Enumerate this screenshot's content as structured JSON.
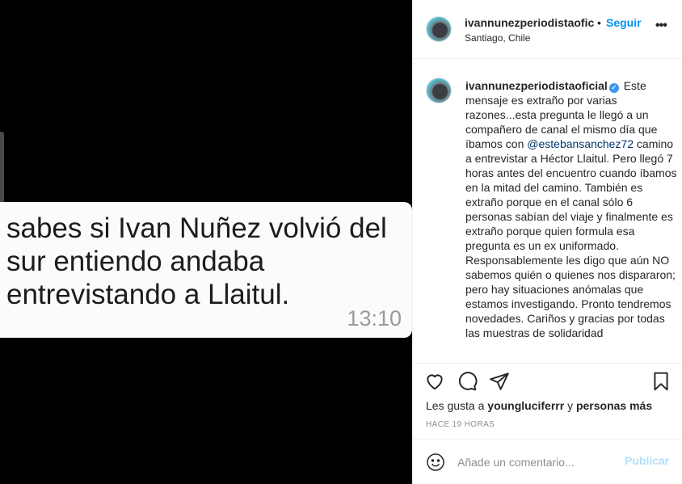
{
  "post": {
    "message_text": "sabes si Ivan Nuñez volvió del\nsur entiendo andaba\nentrevistando a Llaitul.",
    "message_time": "13:10"
  },
  "header": {
    "username": "ivannunezperiodistaofic",
    "separator": "•",
    "follow_label": "Seguir",
    "location": "Santiago, Chile",
    "more_icon": "more-horizontal-icon",
    "more_glyph": "•••"
  },
  "caption": {
    "username": "ivannunezperiodistaoficial",
    "verified_glyph": "✓",
    "text_before": " Este mensaje es extraño por varias razones...esta pregunta le llegó a un compañero de canal el mismo día que íbamos con ",
    "mention": "@estebansanchez72",
    "text_after": " camino a entrevistar a Héctor Llaitul. Pero llegó 7 horas antes del encuentro cuando íbamos en la mitad del camino. También es extraño porque en el canal sólo 6 personas sabían del viaje y finalmente es extraño porque quien formula esa pregunta es un ex uniformado. Responsablemente les digo que aún NO sabemos quién o quienes nos dispararon; pero hay situaciones anómalas que estamos investigando. Pronto tendremos novedades. Cariños y gracias por todas las muestras de solidaridad"
  },
  "actions": {
    "icons": [
      "heart-icon",
      "comment-icon",
      "share-icon",
      "bookmark-icon"
    ]
  },
  "likes": {
    "prefix": "Les gusta a ",
    "user": "youngluciferrr",
    "middle": " y ",
    "others": "personas más"
  },
  "timestamp": "HACE 19 HORAS",
  "comment": {
    "placeholder": "Añade un comentario...",
    "publish_label": "Publicar",
    "emoji_icon": "smiley-icon"
  },
  "colors": {
    "accent": "#0095f6",
    "publish_disabled": "#b2dffc",
    "mention": "#00376b",
    "verified": "#3897f0"
  }
}
